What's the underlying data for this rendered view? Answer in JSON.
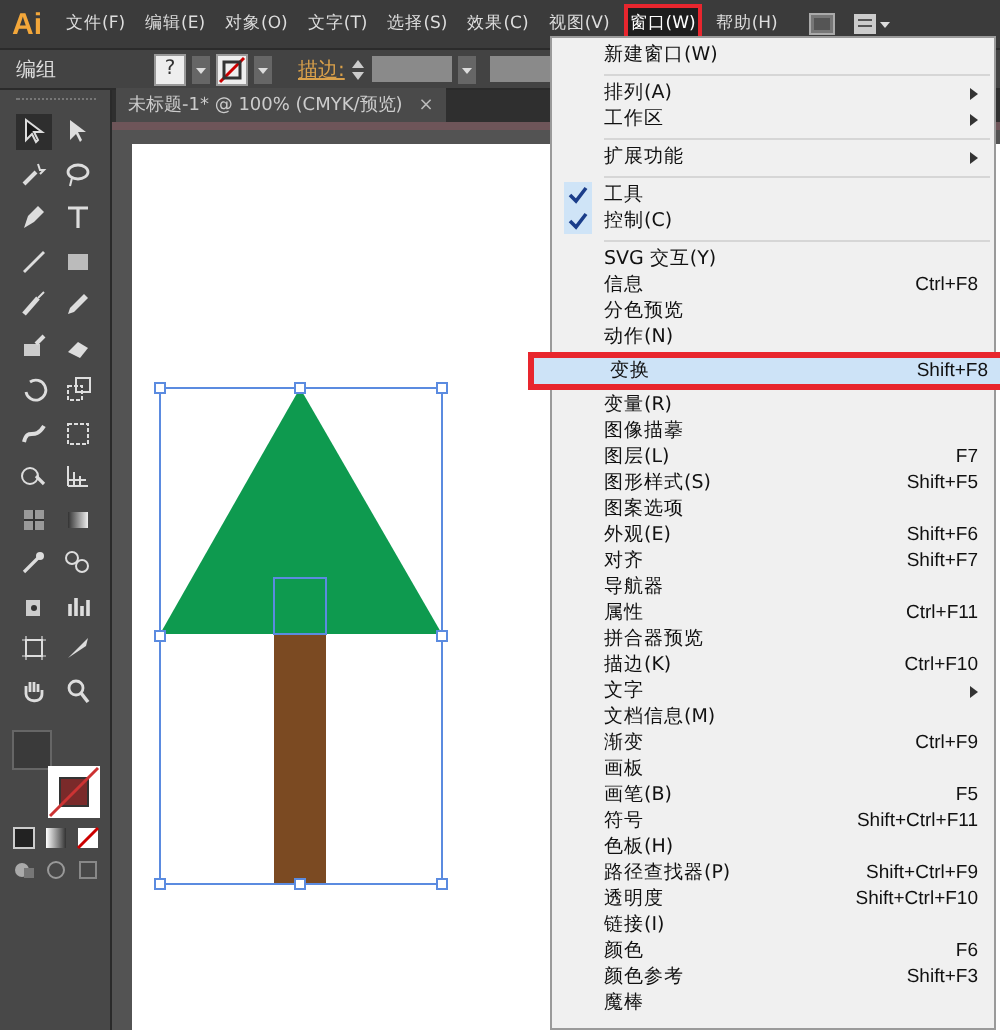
{
  "menu_bar": {
    "items": [
      {
        "label": "文件(F)",
        "selected": false
      },
      {
        "label": "编辑(E)",
        "selected": false
      },
      {
        "label": "对象(O)",
        "selected": false
      },
      {
        "label": "文字(T)",
        "selected": false
      },
      {
        "label": "选择(S)",
        "selected": false
      },
      {
        "label": "效果(C)",
        "selected": false
      },
      {
        "label": "视图(V)",
        "selected": false
      },
      {
        "label": "窗口(W)",
        "selected": true
      },
      {
        "label": "帮助(H)",
        "selected": false
      }
    ]
  },
  "logo": "Ai",
  "control_bar": {
    "selection_label": "编组",
    "fill_swatch": "?",
    "stroke_label": "描边:"
  },
  "document_tab": {
    "title": "未标题-1* @ 100% (CMYK/预览)",
    "close": "×"
  },
  "window_menu": {
    "items": [
      {
        "kind": "item",
        "label": "新建窗口(W)",
        "checked": false,
        "submenu": false,
        "highlighted": false
      },
      {
        "kind": "separator"
      },
      {
        "kind": "item",
        "label": "排列(A)",
        "checked": false,
        "submenu": true,
        "highlighted": false
      },
      {
        "kind": "item",
        "label": "工作区",
        "checked": false,
        "submenu": true,
        "highlighted": false
      },
      {
        "kind": "separator"
      },
      {
        "kind": "item",
        "label": "扩展功能",
        "checked": false,
        "submenu": true,
        "highlighted": false
      },
      {
        "kind": "separator"
      },
      {
        "kind": "item",
        "label": "工具",
        "checked": true,
        "submenu": false,
        "highlighted": false
      },
      {
        "kind": "item",
        "label": "控制(C)",
        "checked": true,
        "submenu": false,
        "highlighted": false
      },
      {
        "kind": "separator"
      },
      {
        "kind": "item",
        "label": "SVG 交互(Y)",
        "checked": false,
        "submenu": false,
        "highlighted": false
      },
      {
        "kind": "item",
        "label": "信息",
        "shortcut": "Ctrl+F8",
        "checked": false,
        "submenu": false,
        "highlighted": false
      },
      {
        "kind": "item",
        "label": "分色预览",
        "checked": false,
        "submenu": false,
        "highlighted": false
      },
      {
        "kind": "item",
        "label": "动作(N)",
        "checked": false,
        "submenu": false,
        "highlighted": false
      },
      {
        "kind": "item",
        "label": "变换",
        "shortcut": "Shift+F8",
        "checked": false,
        "submenu": false,
        "highlighted": true
      },
      {
        "kind": "item",
        "label": "变量(R)",
        "checked": false,
        "submenu": false,
        "highlighted": false
      },
      {
        "kind": "item",
        "label": "图像描摹",
        "checked": false,
        "submenu": false,
        "highlighted": false
      },
      {
        "kind": "item",
        "label": "图层(L)",
        "shortcut": "F7",
        "checked": false,
        "submenu": false,
        "highlighted": false
      },
      {
        "kind": "item",
        "label": "图形样式(S)",
        "shortcut": "Shift+F5",
        "checked": false,
        "submenu": false,
        "highlighted": false
      },
      {
        "kind": "item",
        "label": "图案选项",
        "checked": false,
        "submenu": false,
        "highlighted": false
      },
      {
        "kind": "item",
        "label": "外观(E)",
        "shortcut": "Shift+F6",
        "checked": false,
        "submenu": false,
        "highlighted": false
      },
      {
        "kind": "item",
        "label": "对齐",
        "shortcut": "Shift+F7",
        "checked": false,
        "submenu": false,
        "highlighted": false
      },
      {
        "kind": "item",
        "label": "导航器",
        "checked": false,
        "submenu": false,
        "highlighted": false
      },
      {
        "kind": "item",
        "label": "属性",
        "shortcut": "Ctrl+F11",
        "checked": false,
        "submenu": false,
        "highlighted": false
      },
      {
        "kind": "item",
        "label": "拼合器预览",
        "checked": false,
        "submenu": false,
        "highlighted": false
      },
      {
        "kind": "item",
        "label": "描边(K)",
        "shortcut": "Ctrl+F10",
        "checked": false,
        "submenu": false,
        "highlighted": false
      },
      {
        "kind": "item",
        "label": "文字",
        "checked": false,
        "submenu": true,
        "highlighted": false
      },
      {
        "kind": "item",
        "label": "文档信息(M)",
        "checked": false,
        "submenu": false,
        "highlighted": false
      },
      {
        "kind": "item",
        "label": "渐变",
        "shortcut": "Ctrl+F9",
        "checked": false,
        "submenu": false,
        "highlighted": false
      },
      {
        "kind": "item",
        "label": "画板",
        "checked": false,
        "submenu": false,
        "highlighted": false
      },
      {
        "kind": "item",
        "label": "画笔(B)",
        "shortcut": "F5",
        "checked": false,
        "submenu": false,
        "highlighted": false
      },
      {
        "kind": "item",
        "label": "符号",
        "shortcut": "Shift+Ctrl+F11",
        "checked": false,
        "submenu": false,
        "highlighted": false
      },
      {
        "kind": "item",
        "label": "色板(H)",
        "checked": false,
        "submenu": false,
        "highlighted": false
      },
      {
        "kind": "item",
        "label": "路径查找器(P)",
        "shortcut": "Shift+Ctrl+F9",
        "checked": false,
        "submenu": false,
        "highlighted": false
      },
      {
        "kind": "item",
        "label": "透明度",
        "shortcut": "Shift+Ctrl+F10",
        "checked": false,
        "submenu": false,
        "highlighted": false
      },
      {
        "kind": "item",
        "label": "链接(I)",
        "checked": false,
        "submenu": false,
        "highlighted": false
      },
      {
        "kind": "item",
        "label": "颜色",
        "shortcut": "F6",
        "checked": false,
        "submenu": false,
        "highlighted": false
      },
      {
        "kind": "item",
        "label": "颜色参考",
        "shortcut": "Shift+F3",
        "checked": false,
        "submenu": false,
        "highlighted": false
      },
      {
        "kind": "item",
        "label": "魔棒",
        "checked": false,
        "submenu": false,
        "highlighted": false
      }
    ]
  }
}
